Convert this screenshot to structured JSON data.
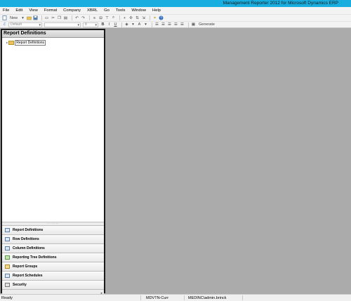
{
  "window": {
    "title": "Management Reporter 2012 for Microsoft Dynamics ERP"
  },
  "menu": [
    "File",
    "Edit",
    "View",
    "Format",
    "Company",
    "XBRL",
    "Go",
    "Tools",
    "Window",
    "Help"
  ],
  "toolbar": {
    "new_label": "New",
    "generate_label": "Generate"
  },
  "format_toolbar": {
    "style_value": "Default",
    "font_value": "",
    "size_value": "8",
    "bold": "B",
    "italic": "I",
    "underline": "U"
  },
  "left_panel": {
    "title": "Report Definitions",
    "tree_root": "Report Definitions",
    "nav_items": [
      {
        "label": "Report Definitions",
        "icon": "report-definitions-icon"
      },
      {
        "label": "Row Definitions",
        "icon": "row-definitions-icon"
      },
      {
        "label": "Column Definitions",
        "icon": "column-definitions-icon"
      },
      {
        "label": "Reporting Tree Definitions",
        "icon": "reporting-tree-icon"
      },
      {
        "label": "Report Groups",
        "icon": "report-groups-icon"
      },
      {
        "label": "Report Schedules",
        "icon": "report-schedules-icon"
      },
      {
        "label": "Security",
        "icon": "security-icon"
      }
    ]
  },
  "status": {
    "left": "Ready",
    "company": "MDVTN-Curr",
    "user": "MEDINC\\admin.brinck"
  }
}
